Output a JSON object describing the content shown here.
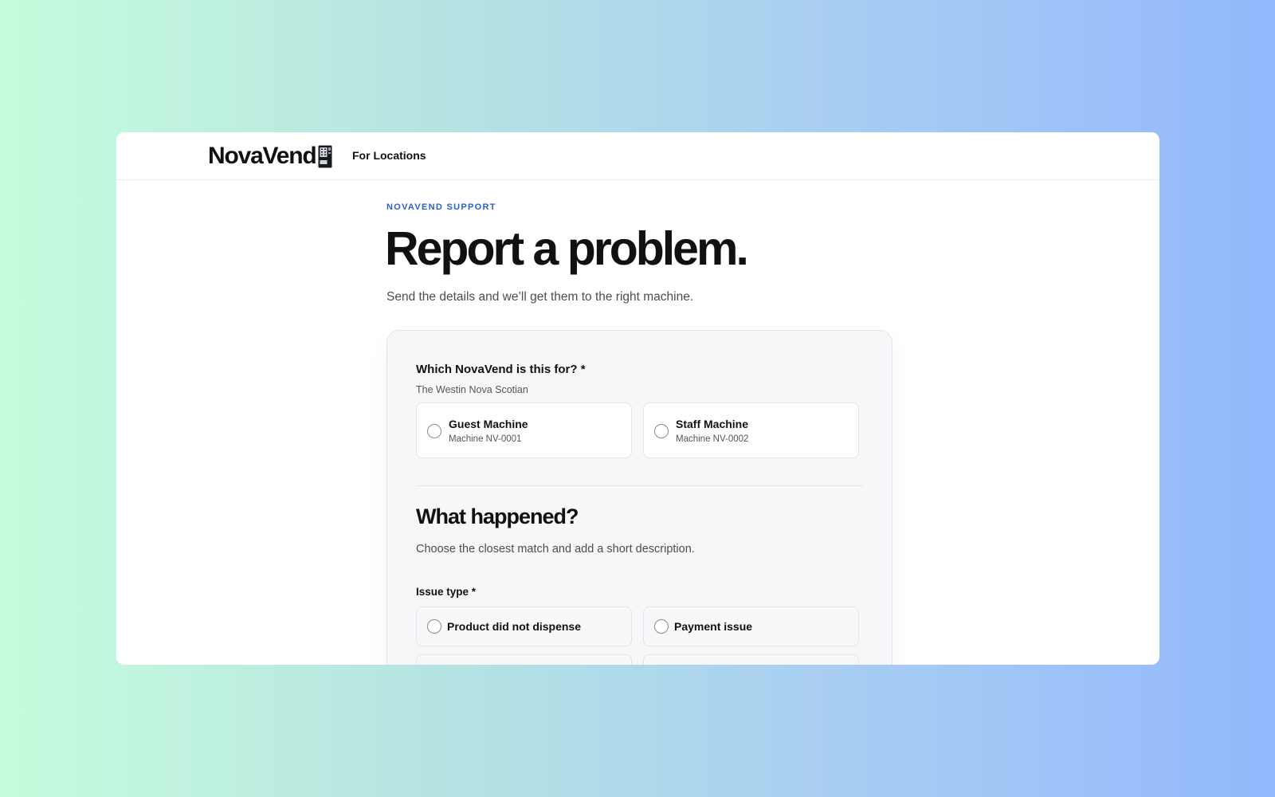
{
  "header": {
    "brand": "NovaVend",
    "brand_icon": "vending-machine-icon",
    "nav_link": "For Locations"
  },
  "hero": {
    "eyebrow": "NOVAVEND SUPPORT",
    "title": "Report a problem.",
    "subtitle": "Send the details and we’ll get them to the right machine."
  },
  "machine_question": {
    "label": "Which NovaVend is this for? *",
    "location": "The Westin Nova Scotian",
    "options": [
      {
        "title": "Guest Machine",
        "subtitle": "Machine NV-0001",
        "selected": false
      },
      {
        "title": "Staff Machine",
        "subtitle": "Machine NV-0002",
        "selected": false
      }
    ]
  },
  "what_happened": {
    "title": "What happened?",
    "description": "Choose the closest match and add a short description.",
    "issue_label": "Issue type *",
    "issue_options": [
      {
        "label": "Product did not dispense",
        "selected": false
      },
      {
        "label": "Payment issue",
        "selected": false
      }
    ]
  },
  "colors": {
    "accent": "#2b5fd0",
    "card_bg": "#f6f7f9",
    "text": "#111111"
  }
}
